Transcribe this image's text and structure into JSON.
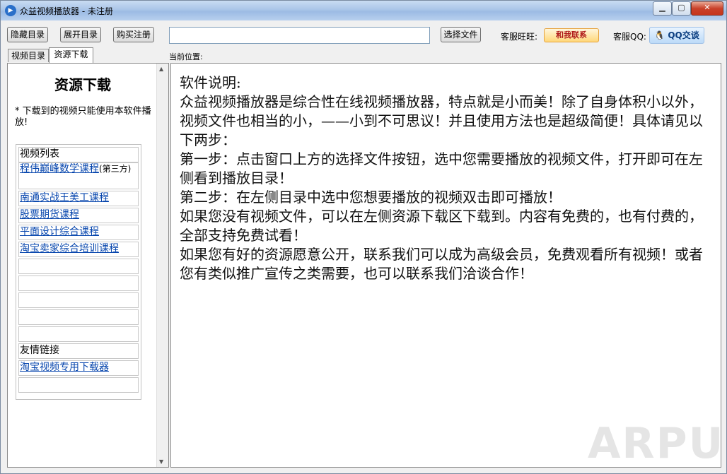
{
  "window": {
    "title": "众益视频播放器 - 未注册",
    "minimize": "▁",
    "maximize": "▢",
    "close": "✕"
  },
  "toolbar": {
    "hide_dir": "隐藏目录",
    "expand_dir": "展开目录",
    "buy_register": "购买注册",
    "path_value": "",
    "choose_file": "选择文件",
    "wangwang_label": "客服旺旺:",
    "wangwang_button": "和我联系",
    "qq_label": "客服QQ:",
    "qq_button": "QQ交谈",
    "current_location_label": "当前位置:"
  },
  "tabs": [
    {
      "label": "视频目录",
      "active": false
    },
    {
      "label": "资源下载",
      "active": true
    }
  ],
  "sidebar": {
    "title": "资源下载",
    "note": "* 下载到的视频只能使用本软件播放!",
    "video_list_header": "视频列表",
    "videos": [
      {
        "label": "程伟巅峰数学课程",
        "suffix": "(第三方)"
      },
      {
        "label": "南通实战王美工课程",
        "suffix": ""
      },
      {
        "label": "股票期货课程",
        "suffix": ""
      },
      {
        "label": "平面设计综合课程",
        "suffix": ""
      },
      {
        "label": "淘宝卖家综合培训课程",
        "suffix": ""
      }
    ],
    "friends_header": "友情链接",
    "friends": [
      {
        "label": "淘宝视频专用下载器"
      }
    ]
  },
  "content": {
    "paragraphs": [
      "软件说明:",
      "众益视频播放器是综合性在线视频播放器，特点就是小而美！除了自身体积小以外，视频文件也相当的小，——小到不可思议！并且使用方法也是超级简便！具体请见以下两步：",
      "第一步：点击窗口上方的选择文件按钮，选中您需要播放的视频文件，打开即可在左侧看到播放目录！",
      "第二步：在左侧目录中选中您想要播放的视频双击即可播放！",
      "如果您没有视频文件，可以在左侧资源下载区下载到。内容有免费的，也有付费的，全部支持免费试看！",
      "如果您有好的资源愿意公开，联系我们可以成为高级会员，免费观看所有视频！或者您有类似推广宣传之类需要，也可以联系我们洽谈合作！"
    ]
  },
  "watermark": "ARPUN"
}
